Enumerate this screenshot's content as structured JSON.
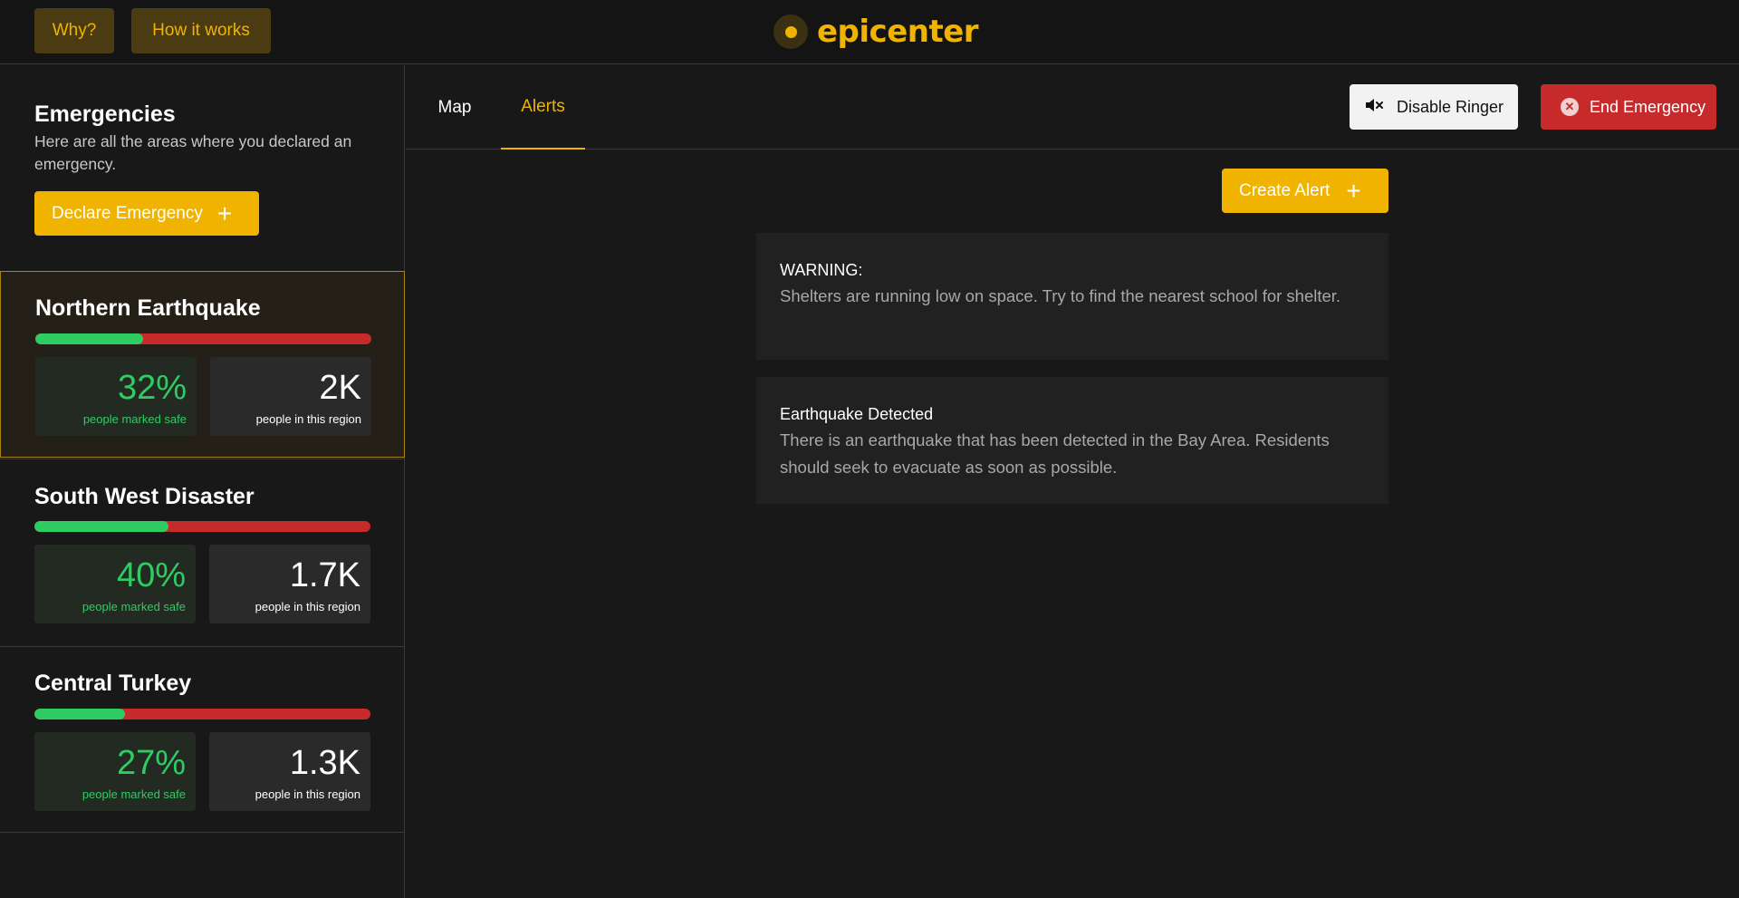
{
  "header": {
    "nav": [
      {
        "label": "Why?"
      },
      {
        "label": "How it works"
      }
    ],
    "logo_text": "epicenter"
  },
  "sidebar": {
    "title": "Emergencies",
    "description": "Here are all the areas where you declared an emergency.",
    "declare_button": "Declare Emergency",
    "emergencies": [
      {
        "name": "Northern Earthquake",
        "safe_fraction": 0.32,
        "safe_value": "32%",
        "safe_label": "people marked safe",
        "region_value": "2K",
        "region_label": "people in this region",
        "active": true
      },
      {
        "name": "South West Disaster",
        "safe_fraction": 0.4,
        "safe_value": "40%",
        "safe_label": "people marked safe",
        "region_value": "1.7K",
        "region_label": "people in this region",
        "active": false
      },
      {
        "name": "Central Turkey",
        "safe_fraction": 0.27,
        "safe_value": "27%",
        "safe_label": "people marked safe",
        "region_value": "1.3K",
        "region_label": "people in this region",
        "active": false
      }
    ]
  },
  "main": {
    "tabs": [
      {
        "label": "Map",
        "active": false
      },
      {
        "label": "Alerts",
        "active": true
      }
    ],
    "disable_ringer_button": "Disable Ringer",
    "end_emergency_button": "End Emergency",
    "create_alert_button": "Create Alert",
    "alerts": [
      {
        "title": "WARNING:",
        "body": "Shelters are running low on space. Try to find the nearest school for shelter."
      },
      {
        "title": "Earthquake Detected",
        "body": "There is an earthquake that has been detected in the Bay Area. Residents should seek to evacuate as soon as possible."
      }
    ]
  },
  "colors": {
    "accent": "#f0b400",
    "safe": "#2ecc63",
    "danger": "#c62a2a",
    "background": "#181818"
  },
  "icons": {
    "logo": "epicenter-logo-icon",
    "plus": "plus-icon",
    "mute": "speaker-muted-icon",
    "close": "close-circle-icon"
  }
}
